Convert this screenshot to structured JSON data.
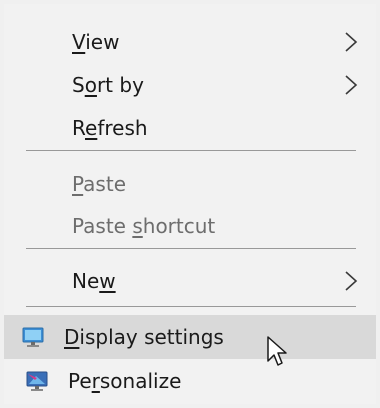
{
  "menu": {
    "items": [
      {
        "label_pre": "",
        "label_u": "V",
        "label_post": "iew"
      },
      {
        "label_pre": "S",
        "label_u": "o",
        "label_post": "rt by"
      },
      {
        "label_pre": "R",
        "label_u": "e",
        "label_post": "fresh"
      },
      {
        "label_pre": "",
        "label_u": "P",
        "label_post": "aste"
      },
      {
        "label_pre": "Paste ",
        "label_u": "s",
        "label_post": "hortcut"
      },
      {
        "label_pre": "Ne",
        "label_u": "w",
        "label_post": ""
      },
      {
        "label_pre": "",
        "label_u": "D",
        "label_post": "isplay settings"
      },
      {
        "label_pre": "Pe",
        "label_u": "r",
        "label_post": "sonalize"
      }
    ]
  },
  "colors": {
    "menu_bg": "#f2f2f2",
    "hover_bg": "#d9d9d9",
    "disabled_text": "#6d6d6d",
    "separator": "#999999"
  },
  "icons": {
    "view_submenu": "chevron-right-icon",
    "sortby_submenu": "chevron-right-icon",
    "new_submenu": "chevron-right-icon",
    "display_settings": "monitor-icon",
    "personalize": "personalize-icon",
    "cursor": "mouse-pointer-icon"
  }
}
